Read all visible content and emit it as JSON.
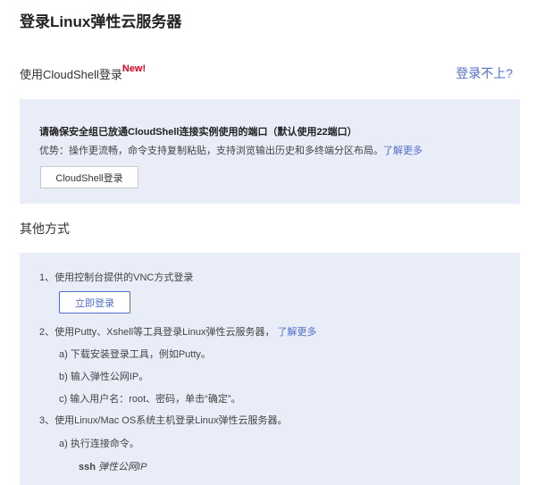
{
  "title": "登录Linux弹性云服务器",
  "cloudshell": {
    "heading": "使用CloudShell登录",
    "badge": "New!",
    "cant_login": "登录不上?",
    "warning": "请确保安全组已放通CloudShell连接实例使用的端口（默认使用22端口）",
    "advantage": "优势：操作更流畅，命令支持复制粘贴，支持浏览输出历史和多终端分区布局。",
    "learn_more": "了解更多",
    "button": "CloudShell登录"
  },
  "other": {
    "heading": "其他方式",
    "item1": "1、使用控制台提供的VNC方式登录",
    "login_now": "立即登录",
    "item2": "2、使用Putty、Xshell等工具登录Linux弹性云服务器，",
    "item2_link": "了解更多",
    "item2a": "a) 下载安装登录工具，例如Putty。",
    "item2b": "b) 输入弹性公网IP。",
    "item2c": "c) 输入用户名：root、密码，单击“确定”。",
    "item3": "3、使用Linux/Mac OS系统主机登录Linux弹性云服务器。",
    "item3a": "a) 执行连接命令。",
    "ssh_cmd": "ssh",
    "ssh_arg": "弹性公网IP"
  }
}
